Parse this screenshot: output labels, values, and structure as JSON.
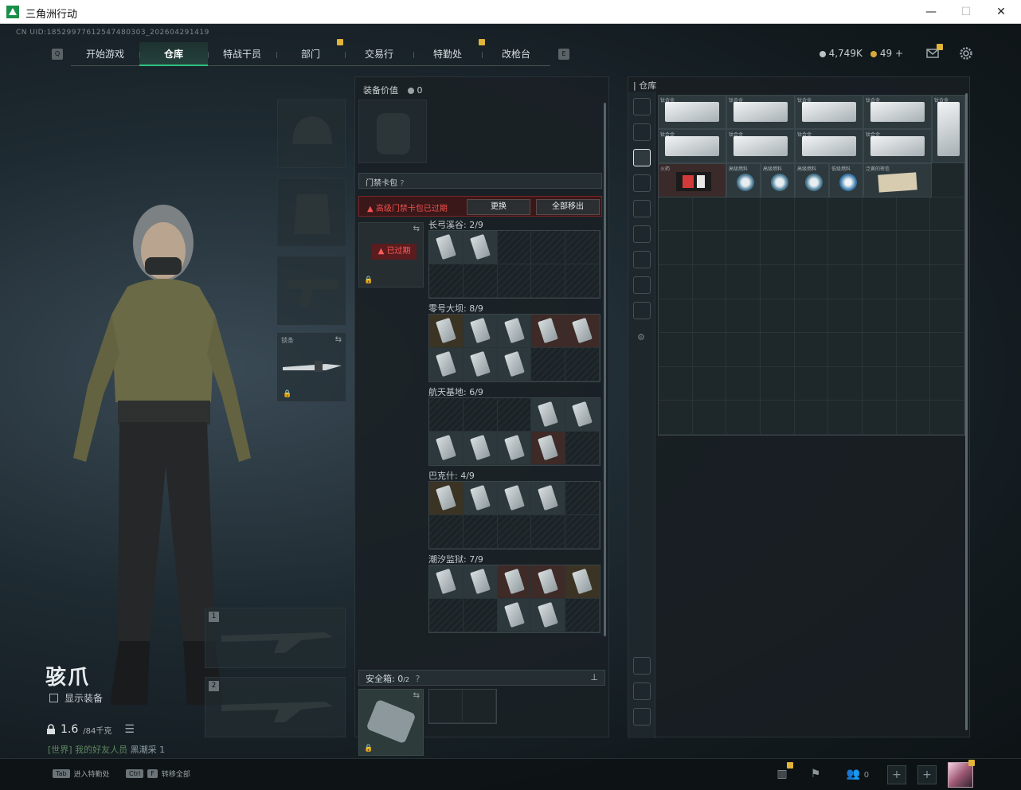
{
  "window": {
    "title": "三角洲行动",
    "minimize": "—",
    "maximize": "☐",
    "close": "✕"
  },
  "uid": "CN UID:18529977612547480303_202604291419",
  "nav": {
    "left_icon": "Q",
    "right_icon": "E",
    "tabs": [
      {
        "label": "开始游戏"
      },
      {
        "label": "仓库",
        "active": true
      },
      {
        "label": "特战干员"
      },
      {
        "label": "部门"
      },
      {
        "label": "交易行"
      },
      {
        "label": "特勤处"
      },
      {
        "label": "改枪台"
      }
    ]
  },
  "currency": {
    "silver": "4,749K",
    "gold": "49",
    "plus": "+"
  },
  "character": {
    "name": "骇爪",
    "show_equipment": "显示装备",
    "weight": "1.6",
    "weight_max": "/84千克",
    "chat_channel": "[世界] 我的好友人员",
    "chat_user": "黑潮采",
    "chat_count": "1"
  },
  "equip_slots": {
    "melee_label": "锁条",
    "weapon1": "1",
    "weapon2": "2"
  },
  "middle": {
    "equip_value_label": "装备价值",
    "equip_value": "0",
    "keycard_section": "门禁卡包",
    "alert_text": "高级门禁卡包已过期",
    "replace_button": "更换",
    "remove_all_button": "全部移出",
    "expired_badge": "已过期",
    "maps": [
      {
        "label": "长弓溪谷: 2/9"
      },
      {
        "label": "零号大坝: 8/9"
      },
      {
        "label": "航天基地: 6/9"
      },
      {
        "label": "巴克什: 4/9"
      },
      {
        "label": "潮汐监狱: 7/9"
      }
    ],
    "safe_label": "安全箱:",
    "safe_count": "0",
    "safe_max": "/2"
  },
  "warehouse": {
    "title": "仓库",
    "items": {
      "plate": "钛合金",
      "fire": "火药",
      "fuel": "高级燃料",
      "gas": "低级燃料",
      "doc": "泛黄的密信"
    }
  },
  "bottom": {
    "hint1_key": "Tab",
    "hint1_text": "进入特勤处",
    "hint2_key": "Ctrl",
    "hint2_key2": "F",
    "hint2_text": "转移全部",
    "friends_count": "0"
  },
  "colors": {
    "accent": "#2ec07f",
    "alert": "#f05050",
    "badge": "#e2b43a"
  }
}
